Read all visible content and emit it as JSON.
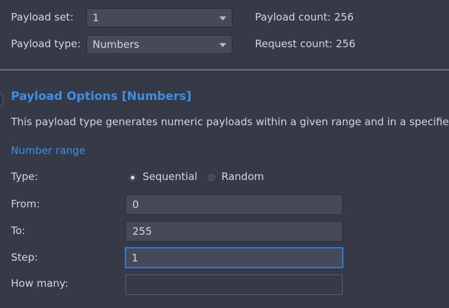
{
  "payload": {
    "set_label": "Payload set:",
    "set_value": "1",
    "type_label": "Payload type:",
    "type_value": "Numbers",
    "count_label": "Payload count:",
    "count_value": "256",
    "request_label": "Request count:",
    "request_value": "256"
  },
  "options": {
    "title": "Payload Options [Numbers]",
    "description": "This payload type generates numeric payloads within a given range and in a specifie",
    "range_heading": "Number range",
    "type_label": "Type:",
    "sequential_label": "Sequential",
    "random_label": "Random",
    "selected_type": "Sequential",
    "from_label": "From:",
    "from_value": "0",
    "to_label": "To:",
    "to_value": "255",
    "step_label": "Step:",
    "step_value": "1",
    "how_many_label": "How many:",
    "how_many_value": ""
  },
  "colors": {
    "background": "#363a47",
    "accent": "#3d8fe8",
    "field": "#464a58",
    "focus_border": "#2f7bd9"
  }
}
